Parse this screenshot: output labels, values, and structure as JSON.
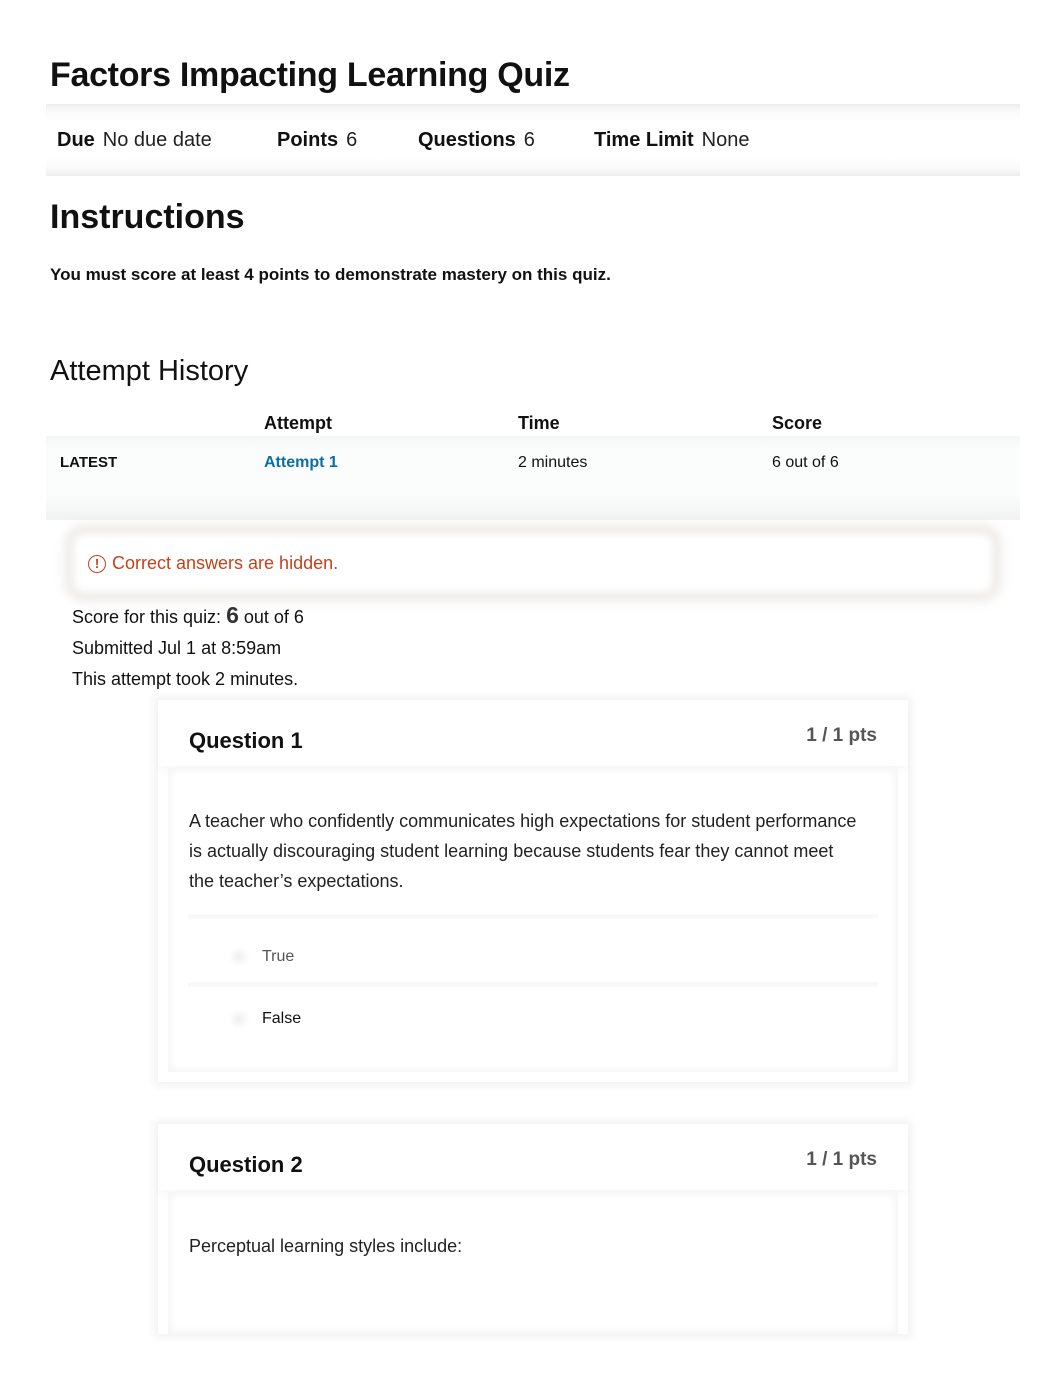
{
  "quiz": {
    "title": "Factors Impacting Learning Quiz",
    "details": {
      "due_label": "Due",
      "due_value": "No due date",
      "points_label": "Points",
      "points_value": "6",
      "questions_label": "Questions",
      "questions_value": "6",
      "time_limit_label": "Time Limit",
      "time_limit_value": "None"
    }
  },
  "instructions": {
    "heading": "Instructions",
    "text": "You must score at least 4 points to demonstrate mastery on this quiz."
  },
  "attempt_history": {
    "heading": "Attempt History",
    "columns": [
      "",
      "Attempt",
      "Time",
      "Score"
    ],
    "rows": [
      {
        "label": "LATEST",
        "attempt": "Attempt 1",
        "time": "2 minutes",
        "score": "6 out of 6"
      }
    ]
  },
  "alert": {
    "icon": "exclamation-circle-icon",
    "text": "Correct answers are hidden.",
    "color": "#c8401a"
  },
  "summary": {
    "score_prefix": "Score for this quiz:",
    "score_value": "6",
    "score_suffix": "out of 6",
    "submitted": "Submitted Jul 1 at 8:59am",
    "duration": "This attempt took 2 minutes."
  },
  "questions": [
    {
      "title": "Question 1",
      "points": "1 / 1 pts",
      "text": "A teacher who confidently communicates high expectations for student performance is actually discouraging student learning because students fear they cannot meet the teacher’s expectations.",
      "answers": [
        "True",
        "False"
      ]
    },
    {
      "title": "Question 2",
      "points": "1 / 1 pts",
      "text": "Perceptual learning styles include:"
    }
  ],
  "colors": {
    "link": "#0b6fa4",
    "alert": "#c8401a"
  }
}
